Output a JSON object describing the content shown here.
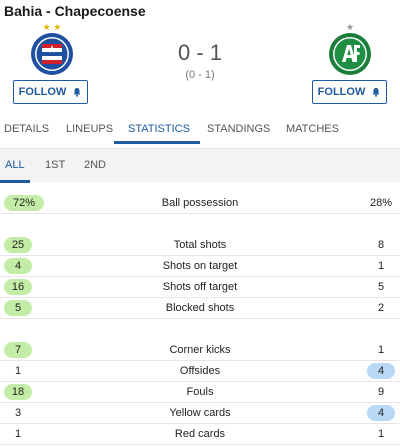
{
  "match": {
    "title": "Bahia - Chapecoense",
    "score": "0 - 1",
    "halftime": "(0 - 1)"
  },
  "home": {
    "crest_icon": "bahia-crest-icon",
    "follow_label": "FOLLOW",
    "stars": 2
  },
  "away": {
    "crest_icon": "chapecoense-crest-icon",
    "follow_label": "FOLLOW",
    "stars": 1
  },
  "tabs": [
    {
      "label": "DETAILS",
      "active": false
    },
    {
      "label": "LINEUPS",
      "active": false
    },
    {
      "label": "STATISTICS",
      "active": true
    },
    {
      "label": "STANDINGS",
      "active": false
    },
    {
      "label": "MATCHES",
      "active": false
    }
  ],
  "periods": [
    {
      "label": "ALL",
      "active": true
    },
    {
      "label": "1ST",
      "active": false
    },
    {
      "label": "2ND",
      "active": false
    }
  ],
  "stats": [
    {
      "name": "Ball possession",
      "home": "72%",
      "away": "28%",
      "leader": "home"
    },
    {
      "name": "Total shots",
      "home": "25",
      "away": "8",
      "leader": "home"
    },
    {
      "name": "Shots on target",
      "home": "4",
      "away": "1",
      "leader": "home"
    },
    {
      "name": "Shots off target",
      "home": "16",
      "away": "5",
      "leader": "home"
    },
    {
      "name": "Blocked shots",
      "home": "5",
      "away": "2",
      "leader": "home"
    },
    {
      "name": "Corner kicks",
      "home": "7",
      "away": "1",
      "leader": "home"
    },
    {
      "name": "Offsides",
      "home": "1",
      "away": "4",
      "leader": "away"
    },
    {
      "name": "Fouls",
      "home": "18",
      "away": "9",
      "leader": "home"
    },
    {
      "name": "Yellow cards",
      "home": "3",
      "away": "4",
      "leader": "away"
    },
    {
      "name": "Red cards",
      "home": "1",
      "away": "1",
      "leader": "none"
    }
  ],
  "colors": {
    "accent": "#1e5aa0",
    "home_highlight": "#c3eda6",
    "away_highlight": "#b8d8f5"
  }
}
